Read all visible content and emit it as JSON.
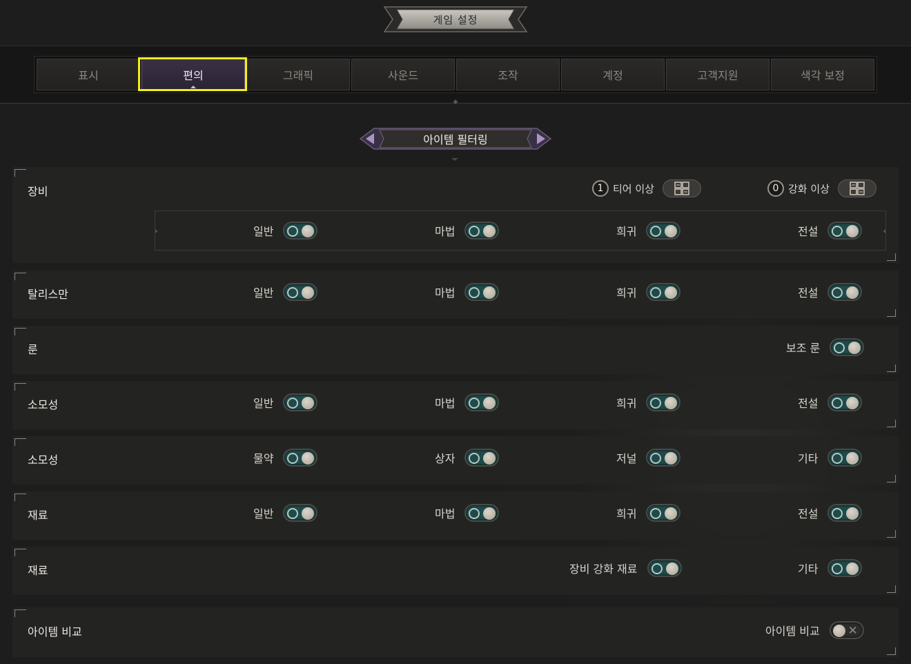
{
  "window": {
    "title": "게임 설정"
  },
  "tabs": [
    {
      "label": "표시"
    },
    {
      "label": "편의"
    },
    {
      "label": "그래픽"
    },
    {
      "label": "사운드"
    },
    {
      "label": "조작"
    },
    {
      "label": "계정"
    },
    {
      "label": "고객지원"
    },
    {
      "label": "색각 보정"
    }
  ],
  "active_tab": "편의",
  "section": {
    "title": "아이템 필터링"
  },
  "equipment": {
    "label": "장비",
    "tier": {
      "value": "1",
      "label": "티어 이상"
    },
    "enhance": {
      "value": "0",
      "label": "강화 이상"
    },
    "options": [
      {
        "label": "일반",
        "on": true
      },
      {
        "label": "마법",
        "on": true
      },
      {
        "label": "희귀",
        "on": true
      },
      {
        "label": "전설",
        "on": true
      }
    ]
  },
  "talisman": {
    "label": "탈리스만",
    "options": [
      {
        "label": "일반",
        "on": true
      },
      {
        "label": "마법",
        "on": true
      },
      {
        "label": "희귀",
        "on": true
      },
      {
        "label": "전설",
        "on": true
      }
    ]
  },
  "rune": {
    "label": "룬",
    "options": [
      {
        "label": "보조 룬",
        "on": true
      }
    ]
  },
  "consumable_rarity": {
    "label": "소모성",
    "options": [
      {
        "label": "일반",
        "on": true
      },
      {
        "label": "마법",
        "on": true
      },
      {
        "label": "희귀",
        "on": true
      },
      {
        "label": "전설",
        "on": true
      }
    ]
  },
  "consumable_type": {
    "label": "소모성",
    "options": [
      {
        "label": "물약",
        "on": true
      },
      {
        "label": "상자",
        "on": true
      },
      {
        "label": "저널",
        "on": true
      },
      {
        "label": "기타",
        "on": true
      }
    ]
  },
  "material_rarity": {
    "label": "재료",
    "options": [
      {
        "label": "일반",
        "on": true
      },
      {
        "label": "마법",
        "on": true
      },
      {
        "label": "희귀",
        "on": true
      },
      {
        "label": "전설",
        "on": true
      }
    ]
  },
  "material_type": {
    "label": "재료",
    "options": [
      {
        "label": "장비 강화 재료",
        "on": true
      },
      {
        "label": "기타",
        "on": true
      }
    ]
  },
  "item_compare": {
    "label": "아이템 비교",
    "options": [
      {
        "label": "아이템 비교",
        "on": false
      }
    ]
  },
  "colors": {
    "toggle_on": "#1f4a4a",
    "active_tab": "#3a3046",
    "highlight": "#f5ee1a"
  }
}
